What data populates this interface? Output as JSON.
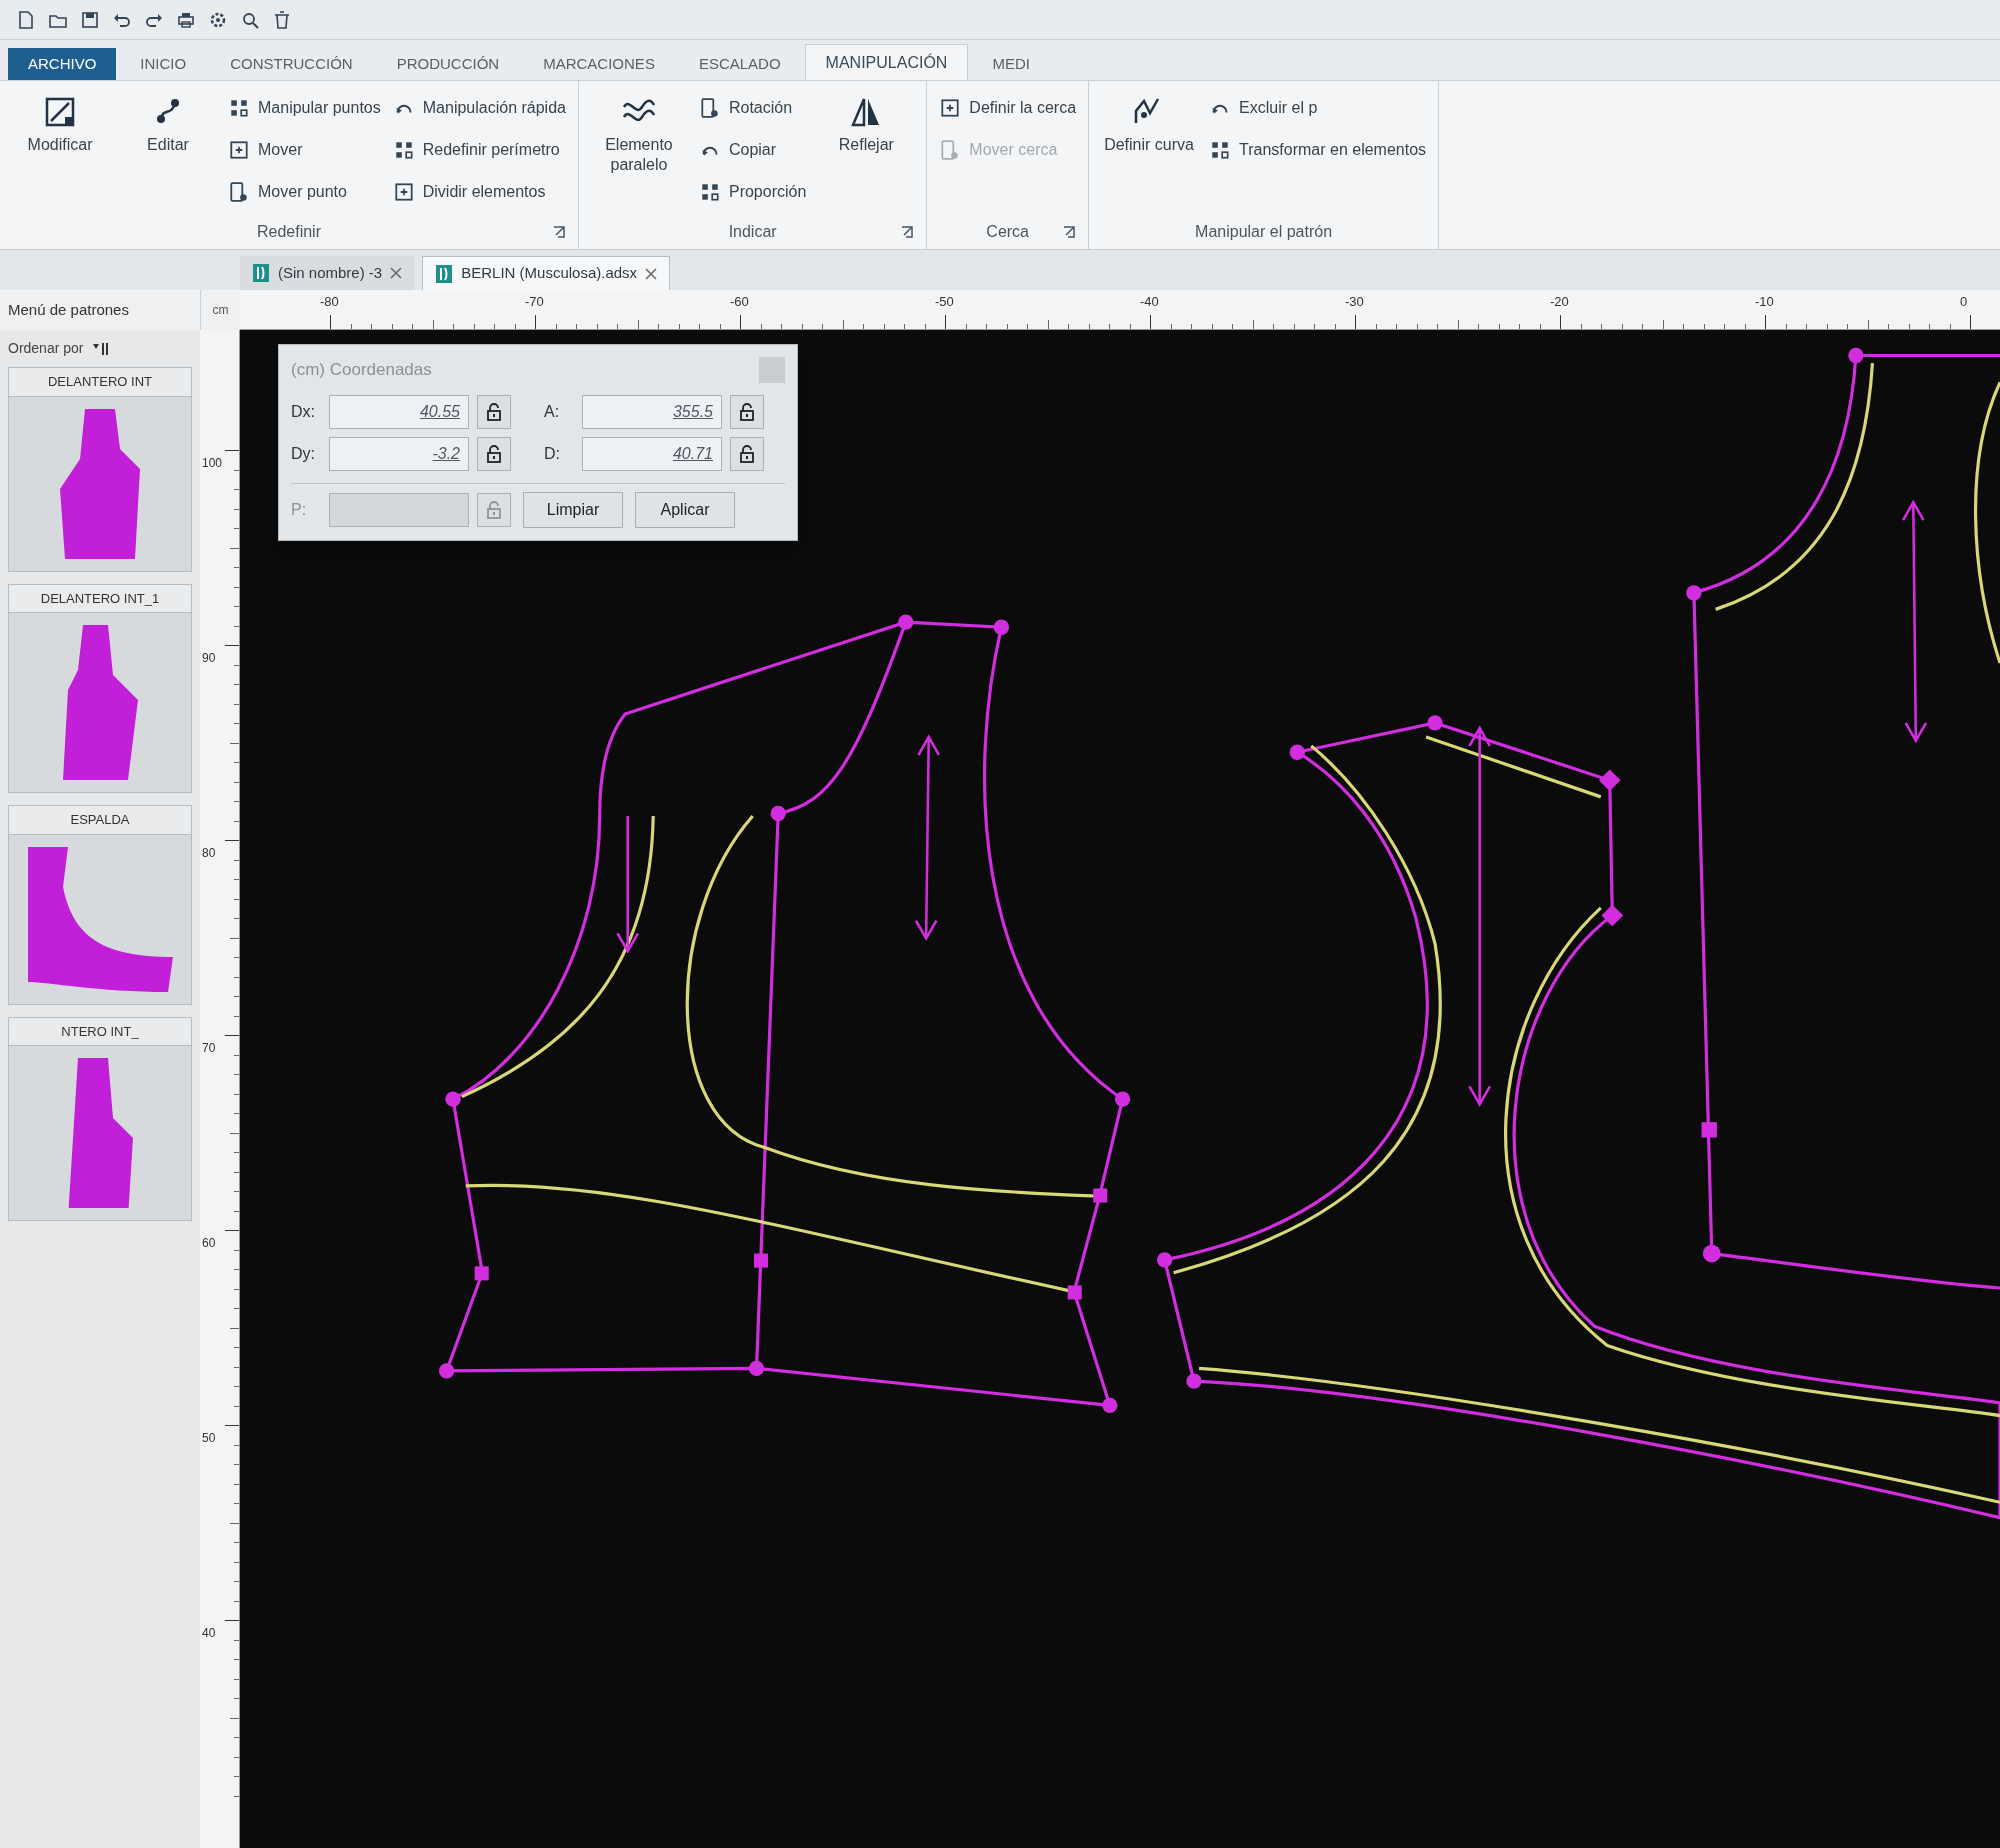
{
  "ribbon_tabs": [
    {
      "kind": "file",
      "label": "ARCHIVO",
      "selected": false
    },
    {
      "kind": "tab",
      "label": "INICIO",
      "selected": false
    },
    {
      "kind": "tab",
      "label": "CONSTRUCCIÓN",
      "selected": false
    },
    {
      "kind": "tab",
      "label": "PRODUCCIÓN",
      "selected": false
    },
    {
      "kind": "tab",
      "label": "MARCACIONES",
      "selected": false
    },
    {
      "kind": "tab",
      "label": "ESCALADO",
      "selected": false
    },
    {
      "kind": "tab",
      "label": "MANIPULACIÓN",
      "selected": true
    },
    {
      "kind": "tab",
      "label": "MEDI",
      "selected": false
    }
  ],
  "ribbon_groups": [
    {
      "label": "Redefinir",
      "launcher": true,
      "items": [
        {
          "kind": "large",
          "label": "Modificar",
          "disabled": false
        },
        {
          "kind": "large",
          "label": "Editar",
          "disabled": false
        },
        {
          "kind": "small",
          "label": "Manipular puntos",
          "disabled": false
        },
        {
          "kind": "small",
          "label": "Mover",
          "disabled": false
        },
        {
          "kind": "small",
          "label": "Mover punto",
          "disabled": false
        },
        {
          "kind": "small",
          "label": "Manipulación rápida",
          "disabled": false
        },
        {
          "kind": "small",
          "label": "Redefinir perímetro",
          "disabled": false
        },
        {
          "kind": "small",
          "label": "Dividir elementos",
          "disabled": false
        }
      ]
    },
    {
      "label": "Indicar",
      "launcher": true,
      "items": [
        {
          "kind": "large",
          "label": "Elemento paralelo",
          "disabled": false
        },
        {
          "kind": "small",
          "label": "Rotación",
          "disabled": false
        },
        {
          "kind": "small",
          "label": "Copiar",
          "disabled": false
        },
        {
          "kind": "small",
          "label": "Proporción",
          "disabled": false
        },
        {
          "kind": "large",
          "label": "Reflejar",
          "disabled": false
        }
      ]
    },
    {
      "label": "Cerca",
      "launcher": true,
      "items": [
        {
          "kind": "small",
          "label": "Definir la cerca",
          "disabled": false
        },
        {
          "kind": "small",
          "label": "Mover cerca",
          "disabled": true
        }
      ]
    },
    {
      "label": "Manipular el patrón",
      "launcher": false,
      "items": [
        {
          "kind": "large",
          "label": "Definir curva",
          "disabled": false
        },
        {
          "kind": "small",
          "label": "Excluir el p",
          "disabled": false
        },
        {
          "kind": "small",
          "label": "Transformar en elementos",
          "disabled": false
        }
      ]
    }
  ],
  "document_tabs": [
    {
      "label": "(Sin nombre) -3",
      "selected": false
    },
    {
      "label": "BERLIN (Musculosa).adsx",
      "selected": true
    }
  ],
  "ruler": {
    "unit": "cm",
    "horizontal_labels": [
      "-80",
      "-70",
      "-60",
      "-50",
      "-40",
      "-30",
      "-20",
      "-10",
      "0"
    ],
    "vertical_labels": [
      "100",
      "90",
      "80",
      "70",
      "60",
      "50",
      "40"
    ]
  },
  "pattern_menu": {
    "title": "Menú de patrones",
    "sort_label": "Ordenar por",
    "patterns": [
      {
        "name": "DELANTERO INT"
      },
      {
        "name": "DELANTERO INT_1"
      },
      {
        "name": "ESPALDA"
      },
      {
        "name": "NTERO INT_"
      }
    ]
  },
  "coordinates_dialog": {
    "title": "(cm) Coordenadas",
    "fields": [
      {
        "label": "Dx:",
        "value": "40.55",
        "disabled": false
      },
      {
        "label": "A:",
        "value": "355.5",
        "disabled": false
      },
      {
        "label": "Dy:",
        "value": "-3.2",
        "disabled": false
      },
      {
        "label": "D:",
        "value": "40.71",
        "disabled": false
      },
      {
        "label": "P:",
        "disabled": true
      }
    ],
    "buttons": [
      "Limpiar",
      "Aplicar"
    ]
  }
}
